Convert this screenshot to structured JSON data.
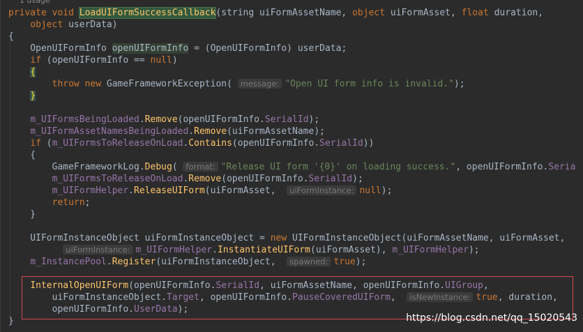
{
  "usage_label": "1 usage",
  "lines": [
    [
      {
        "t": "private void ",
        "c": "kw"
      },
      {
        "t": "LoadUIFormSuccessCallback",
        "c": "fn-decl"
      },
      {
        "t": "(string uiFormAssetName, "
      },
      {
        "t": "object",
        "c": "kw"
      },
      {
        "t": " uiFormAsset, "
      },
      {
        "t": "float",
        "c": "kw"
      },
      {
        "t": " duration,"
      }
    ],
    [
      {
        "t": "    "
      },
      {
        "t": "object",
        "c": "kw"
      },
      {
        "t": " userData)"
      }
    ],
    [
      {
        "t": "{"
      }
    ],
    [
      {
        "t": "    OpenUIFormInfo "
      },
      {
        "t": "openUIFormInfo",
        "c": "var-hl"
      },
      {
        "t": " = (OpenUIFormInfo) userData;"
      }
    ],
    [
      {
        "t": "    "
      },
      {
        "t": "if",
        "c": "kw"
      },
      {
        "t": " (openUIFormInfo == "
      },
      {
        "t": "null",
        "c": "kw"
      },
      {
        "t": ")"
      }
    ],
    [
      {
        "t": "    "
      },
      {
        "t": "{",
        "c": "brace-hl"
      }
    ],
    [
      {
        "t": "        "
      },
      {
        "t": "throw new",
        "c": "kw"
      },
      {
        "t": " GameFrameworkException( "
      },
      {
        "h": "message:"
      },
      {
        "t": "\"Open UI form info is invalid.\"",
        "c": "str"
      },
      {
        "t": ");"
      }
    ],
    [
      {
        "t": "    "
      },
      {
        "t": "}",
        "c": "brace-hl"
      }
    ],
    [],
    [
      {
        "t": "    "
      },
      {
        "t": "m_UIFormsBeingLoaded",
        "c": "fld"
      },
      {
        "t": "."
      },
      {
        "t": "Remove",
        "c": "mth"
      },
      {
        "t": "(openUIFormInfo."
      },
      {
        "t": "SerialId",
        "c": "prop"
      },
      {
        "t": ");"
      }
    ],
    [
      {
        "t": "    "
      },
      {
        "t": "m_UIFormAssetNamesBeingLoaded",
        "c": "fld"
      },
      {
        "t": "."
      },
      {
        "t": "Remove",
        "c": "mth"
      },
      {
        "t": "(uiFormAssetName);"
      }
    ],
    [
      {
        "t": "    "
      },
      {
        "t": "if",
        "c": "kw"
      },
      {
        "t": " ("
      },
      {
        "t": "m_UIFormsToReleaseOnLoad",
        "c": "fld"
      },
      {
        "t": "."
      },
      {
        "t": "Contains",
        "c": "mth"
      },
      {
        "t": "(openUIFormInfo."
      },
      {
        "t": "SerialId",
        "c": "prop"
      },
      {
        "t": "))"
      }
    ],
    [
      {
        "t": "    {"
      }
    ],
    [
      {
        "t": "        GameFrameworkLog."
      },
      {
        "t": "Debug",
        "c": "mth"
      },
      {
        "t": "( "
      },
      {
        "h": "format:"
      },
      {
        "t": "\"Release UI form '{0}' on loading success.\"",
        "c": "str"
      },
      {
        "t": ", openUIFormInfo."
      },
      {
        "t": "Seria",
        "c": "prop"
      }
    ],
    [
      {
        "t": "        "
      },
      {
        "t": "m_UIFormsToReleaseOnLoad",
        "c": "fld"
      },
      {
        "t": "."
      },
      {
        "t": "Remove",
        "c": "mth"
      },
      {
        "t": "(openUIFormInfo."
      },
      {
        "t": "SerialId",
        "c": "prop"
      },
      {
        "t": ");"
      }
    ],
    [
      {
        "t": "        "
      },
      {
        "t": "m_UIFormHelper",
        "c": "fld"
      },
      {
        "t": "."
      },
      {
        "t": "ReleaseUIForm",
        "c": "mth"
      },
      {
        "t": "(uiFormAsset,  "
      },
      {
        "h": "uiFormInstance:"
      },
      {
        "t": "null",
        "c": "kw"
      },
      {
        "t": ");"
      }
    ],
    [
      {
        "t": "        "
      },
      {
        "t": "return",
        "c": "kw"
      },
      {
        "t": ";"
      }
    ],
    [
      {
        "t": "    }"
      }
    ],
    [],
    [
      {
        "t": "    UIFormInstanceObject uiFormInstanceObject = "
      },
      {
        "t": "new",
        "c": "kw"
      },
      {
        "t": " UIFormInstanceObject(uiFormAssetName, uiFormAsset,"
      }
    ],
    [
      {
        "t": "          "
      },
      {
        "h": "uiFormInstance:"
      },
      {
        "t": "m_UIFormHelper",
        "c": "fld"
      },
      {
        "t": "."
      },
      {
        "t": "InstantiateUIForm",
        "c": "mth"
      },
      {
        "t": "(uiFormAsset), "
      },
      {
        "t": "m_UIFormHelper",
        "c": "fld"
      },
      {
        "t": ");"
      }
    ],
    [
      {
        "t": "    "
      },
      {
        "t": "m_InstancePool",
        "c": "fld"
      },
      {
        "t": "."
      },
      {
        "t": "Register",
        "c": "mth"
      },
      {
        "t": "(uiFormInstanceObject,  "
      },
      {
        "h": "spawned:"
      },
      {
        "t": "true",
        "c": "kw"
      },
      {
        "t": ");"
      }
    ],
    [],
    [
      {
        "t": "    "
      },
      {
        "t": "InternalOpenUIForm",
        "c": "mth"
      },
      {
        "t": "(openUIFormInfo."
      },
      {
        "t": "SerialId",
        "c": "prop"
      },
      {
        "t": ", uiFormAssetName, openUIFormInfo."
      },
      {
        "t": "UIGroup",
        "c": "prop"
      },
      {
        "t": ","
      }
    ],
    [
      {
        "t": "        uiFormInstanceObject."
      },
      {
        "t": "Target",
        "c": "prop"
      },
      {
        "t": ", openUIFormInfo."
      },
      {
        "t": "PauseCoveredUIForm",
        "c": "prop"
      },
      {
        "t": ",  "
      },
      {
        "h": "isNewInstance:"
      },
      {
        "t": "true",
        "c": "kw"
      },
      {
        "t": ", duration,"
      }
    ],
    [
      {
        "t": "        openUIFormInfo."
      },
      {
        "t": "UserData",
        "c": "prop"
      },
      {
        "t": ");"
      }
    ],
    [
      {
        "t": "}"
      }
    ]
  ],
  "watermark": "https://blog.csdn.net/qq_15020543"
}
